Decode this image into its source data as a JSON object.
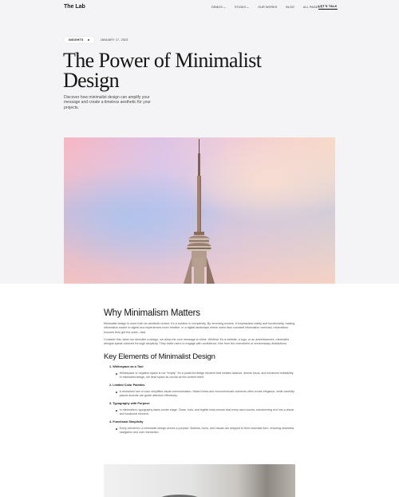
{
  "site": {
    "logo": "The Lab"
  },
  "nav": {
    "items": [
      {
        "label": "DEMOS",
        "has_dropdown": true
      },
      {
        "label": "STUDIO",
        "has_dropdown": true
      },
      {
        "label": "OUR WORKS",
        "has_dropdown": false
      },
      {
        "label": "BLOG",
        "has_dropdown": false
      },
      {
        "label": "ALL PAGES",
        "has_dropdown": true
      }
    ],
    "cta": "LET'S TALK"
  },
  "post": {
    "category": "INSIGHTS",
    "date": "JANUARY 17, 2023",
    "title_line1": "The Power of Minimalist",
    "title_line2": "Design",
    "subtitle": "Discover how minimalist design can amplify your message and create a timeless aesthetic for your projects."
  },
  "article": {
    "section1_heading": "Why Minimalism Matters",
    "section1_p1": "Minimalist design is more than an aesthetic choice; it's a solution to complexity. By removing excess, it emphasizes clarity and functionality, making information easier to digest and experiences more intuitive. In a digital landscape where users face constant information overload, minimalism ensures they get the point—fast.",
    "section1_p2": "Consider this: when we declutter a design, we allow the core message to shine. Whether it's a website, a logo, or an advertisement, minimalist designs speak volumes through simplicity. They invite users to engage with confidence, free from the overwhelm of unnecessary distractions.",
    "section2_heading": "Key Elements of Minimalist Design",
    "elements": [
      {
        "title": "1. Whitespace as a Tool",
        "body": "Whitespace or negative space is not \"empty;\" it's a powerful design element that creates balance, directs focus, and enhances readability. In minimalist design, we treat space as crucial as the content itself."
      },
      {
        "title": "2. Limited Color Palettes",
        "body": "A restrained use of color simplifies visual communication. Muted tones and monochromatic schemes often evoke elegance, while carefully placed accents can guide attention effectively."
      },
      {
        "title": "3. Typography with Purpose",
        "body": "In minimalism, typography takes center stage. Clean, bold, and legible fonts ensure that every word counts, transforming text into a visual and functional element."
      },
      {
        "title": "4. Functional Simplicity",
        "body": "Every element in a minimalist design serves a purpose. Buttons, icons, and visuals are stripped to their essential form, ensuring seamless navigation and user interaction."
      }
    ]
  },
  "colors": {
    "page_top": "#f4f4f6",
    "sky_pink": "#f4b9c6",
    "sky_blue": "#a9c3ec",
    "sky_peach": "#f3cdb8",
    "tower": "#7a5a45"
  }
}
